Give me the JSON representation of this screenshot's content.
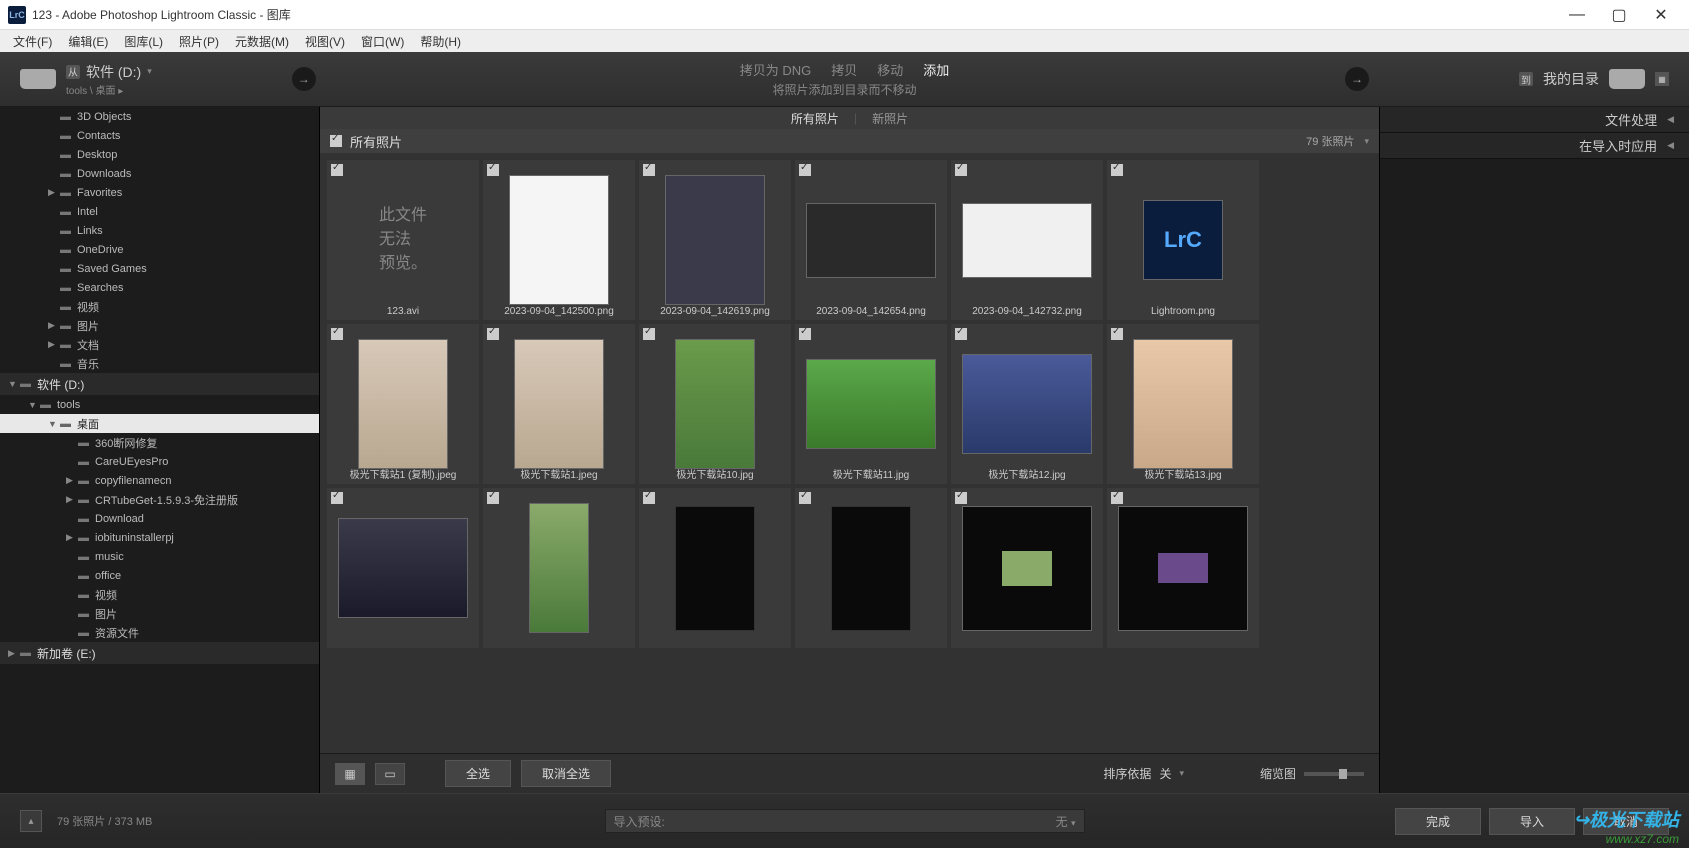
{
  "titlebar": {
    "icon_text": "LrC",
    "title": "123 - Adobe Photoshop Lightroom Classic - 图库"
  },
  "menubar": [
    "文件(F)",
    "编辑(E)",
    "图库(L)",
    "照片(P)",
    "元数据(M)",
    "视图(V)",
    "窗口(W)",
    "帮助(H)"
  ],
  "header": {
    "from_badge": "从",
    "source_label": "软件 (D:)",
    "source_sub": "tools \\ 桌面 ▸",
    "copy_modes": [
      "拷贝为 DNG",
      "拷贝",
      "移动",
      "添加"
    ],
    "copy_mode_active": 3,
    "copy_desc": "将照片添加到目录而不移动",
    "to_badge": "到",
    "dest_label": "我的目录"
  },
  "left_panel": {
    "top_folders": [
      {
        "name": "3D Objects"
      },
      {
        "name": "Contacts"
      },
      {
        "name": "Desktop"
      },
      {
        "name": "Downloads"
      },
      {
        "name": "Favorites",
        "exp": "▶"
      },
      {
        "name": "Intel"
      },
      {
        "name": "Links"
      },
      {
        "name": "OneDrive"
      },
      {
        "name": "Saved Games"
      },
      {
        "name": "Searches"
      },
      {
        "name": "视频"
      },
      {
        "name": "图片",
        "exp": "▶"
      },
      {
        "name": "文档",
        "exp": "▶"
      },
      {
        "name": "音乐"
      }
    ],
    "drive": "软件 (D:)",
    "tools": "tools",
    "desktop": "桌面",
    "sub_folders": [
      {
        "name": "360断网修复"
      },
      {
        "name": "CareUEyesPro"
      },
      {
        "name": "copyfilenamecn",
        "exp": "▶"
      },
      {
        "name": "CRTubeGet-1.5.9.3-免注册版",
        "exp": "▶"
      },
      {
        "name": "Download"
      },
      {
        "name": "iobituninstallerpj",
        "exp": "▶"
      },
      {
        "name": "music"
      },
      {
        "name": "office"
      },
      {
        "name": "视频"
      },
      {
        "name": "图片"
      },
      {
        "name": "资源文件"
      }
    ],
    "new_volume": "新加卷 (E:)"
  },
  "center": {
    "tabs": [
      "所有照片",
      "新照片"
    ],
    "tab_active": 0,
    "all_label": "所有照片",
    "count": "79 张照片",
    "thumbs_row1": [
      {
        "label": "123.avi",
        "preview": "no"
      },
      {
        "label": "2023-09-04_142500.png",
        "preview": "dialog"
      },
      {
        "label": "2023-09-04_142619.png",
        "preview": "dialog2"
      },
      {
        "label": "2023-09-04_142654.png",
        "preview": "window"
      },
      {
        "label": "2023-09-04_142732.png",
        "preview": "window2"
      },
      {
        "label": "Lightroom.png",
        "preview": "lrc"
      }
    ],
    "thumbs_row2": [
      {
        "label": "极光下载站1 (复制).jpeg",
        "preview": "portrait"
      },
      {
        "label": "极光下载站1.jpeg",
        "preview": "portrait"
      },
      {
        "label": "极光下载站10.jpg",
        "preview": "landscape-tall"
      },
      {
        "label": "极光下载站11.jpg",
        "preview": "landscape"
      },
      {
        "label": "极光下载站12.jpg",
        "preview": "anime"
      },
      {
        "label": "极光下载站13.jpg",
        "preview": "anime2"
      }
    ],
    "thumbs_row3": [
      {
        "label": "",
        "preview": "dark-portrait"
      },
      {
        "label": "",
        "preview": "collage"
      },
      {
        "label": "",
        "preview": "model-dark"
      },
      {
        "label": "",
        "preview": "model-dark2"
      },
      {
        "label": "",
        "preview": "tiny-green"
      },
      {
        "label": "",
        "preview": "tiny-purple"
      }
    ],
    "no_preview_text": "此文件\n无法\n预览。",
    "toolbar": {
      "select_all": "全选",
      "deselect_all": "取消全选",
      "sort_label": "排序依据",
      "sort_value": "关",
      "thumb_label": "缩览图"
    }
  },
  "right_panel": {
    "section1": "文件处理",
    "section2": "在导入时应用"
  },
  "footer": {
    "status": "79 张照片 / 373 MB",
    "preset_label": "导入预设:",
    "preset_value": "无",
    "btn_done": "完成",
    "btn_import": "导入",
    "btn_cancel": "取消"
  },
  "watermark": {
    "main": "↪极光下载站",
    "sub": "www.xz7.com"
  }
}
